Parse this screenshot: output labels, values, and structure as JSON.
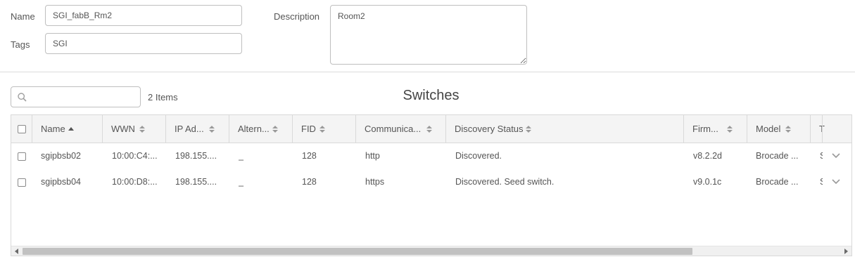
{
  "form": {
    "name_label": "Name",
    "name_value": "SGI_fabB_Rm2",
    "tags_label": "Tags",
    "tags_value": "SGI",
    "description_label": "Description",
    "description_value": "Room2"
  },
  "toolbar": {
    "search_placeholder": "",
    "items_count": "2 Items",
    "title": "Switches"
  },
  "table": {
    "columns": [
      {
        "label": "Name",
        "sort": "ascending"
      },
      {
        "label": "WWN",
        "sort": "none"
      },
      {
        "label": "IP Ad...",
        "sort": "none"
      },
      {
        "label": "Altern...",
        "sort": "none"
      },
      {
        "label": "FID",
        "sort": "none"
      },
      {
        "label": "Communica...",
        "sort": "none"
      },
      {
        "label": "Discovery Status",
        "sort": "none"
      },
      {
        "label": "Firm...",
        "sort": "none"
      },
      {
        "label": "Model",
        "sort": "none"
      },
      {
        "label": "T",
        "sort": "none"
      }
    ],
    "rows": [
      {
        "name": "sgipbsb02",
        "wwn": "10:00:C4:...",
        "ip": "198.155....",
        "alt": "_",
        "fid": "128",
        "comm": "http",
        "status": "Discovered.",
        "firmware": "v8.2.2d",
        "model": "Brocade ...",
        "t": "S"
      },
      {
        "name": "sgipbsb04",
        "wwn": "10:00:D8:...",
        "ip": "198.155....",
        "alt": "_",
        "fid": "128",
        "comm": "https",
        "status": "Discovered. Seed switch.",
        "firmware": "v9.0.1c",
        "model": "Brocade ...",
        "t": "S"
      }
    ]
  },
  "icons": {
    "search": "search-icon",
    "sort_asc": "sort-asc-icon",
    "sort_both": "sort-icon",
    "expand": "chevron-down-icon"
  }
}
